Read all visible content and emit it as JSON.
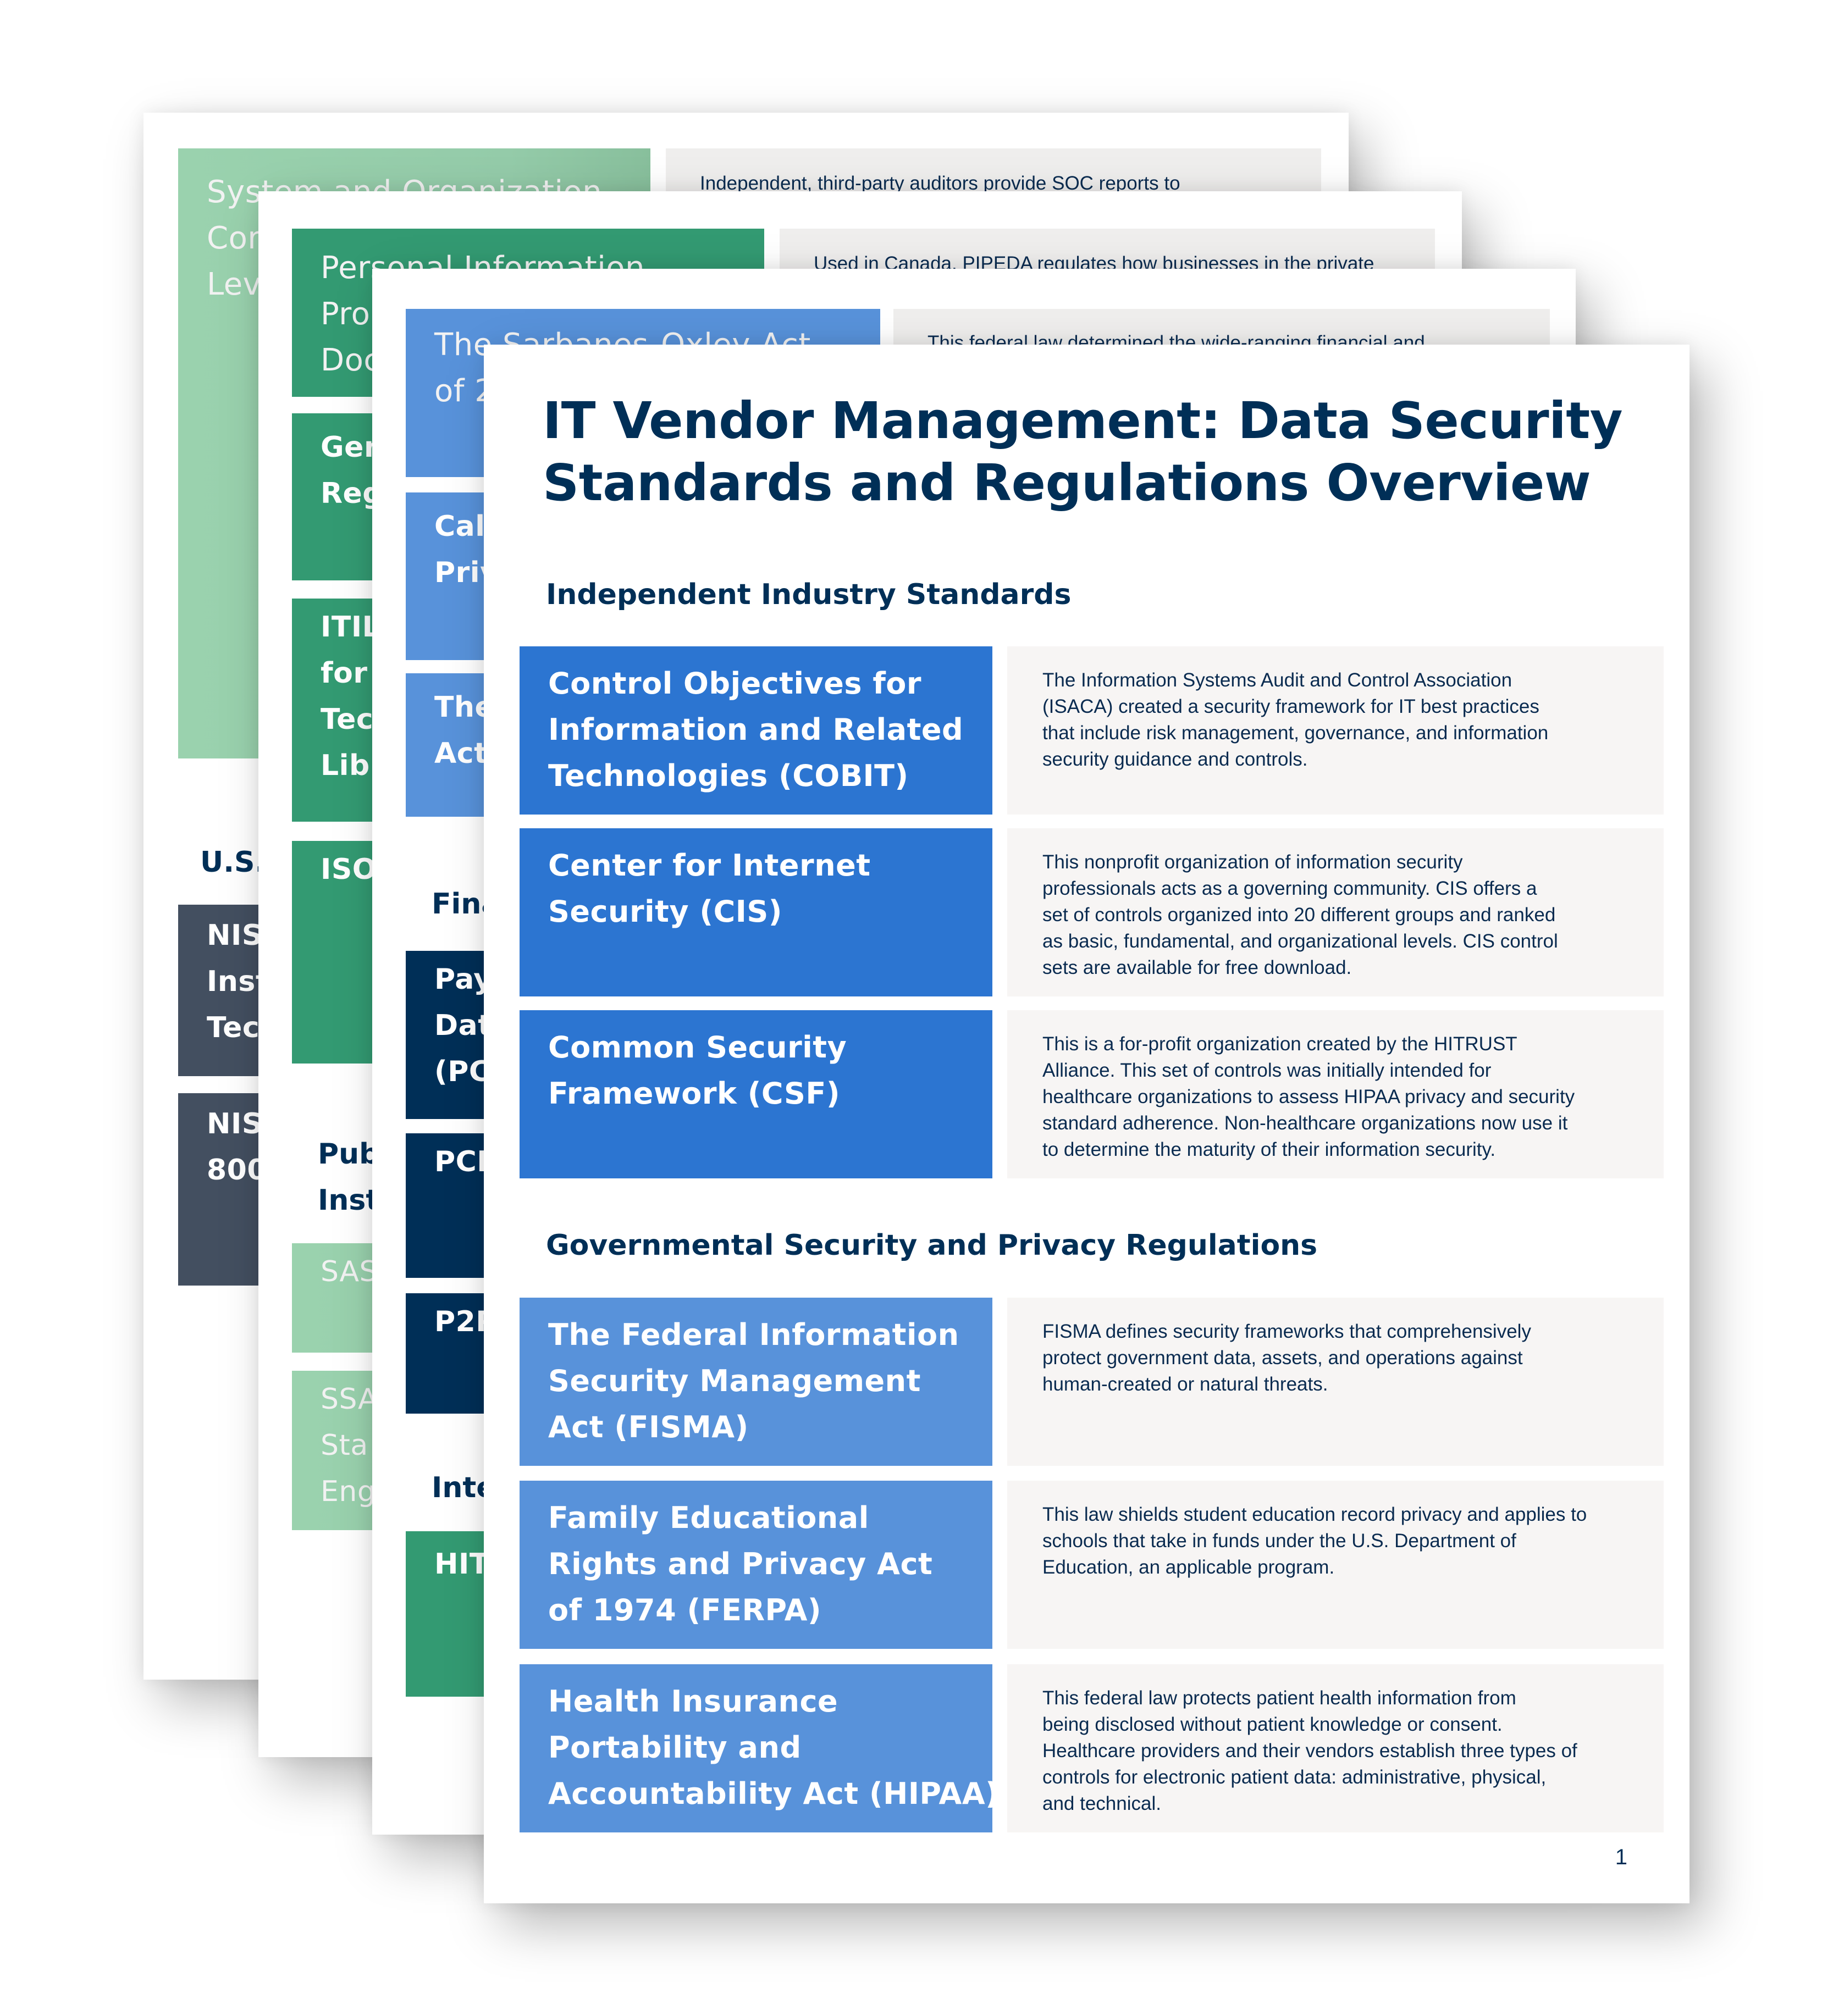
{
  "document": {
    "title_lines": [
      "IT Vendor Management: Data Security",
      "Standards and Regulations Overview"
    ],
    "page_number": "1",
    "sections": [
      {
        "heading": "Independent Industry Standards",
        "rows": [
          {
            "label_lines": [
              "Control Objectives for",
              "Information and Related",
              "Technologies (COBIT)"
            ],
            "description_lines": [
              "The Information Systems Audit and Control Association",
              "(ISACA) created a security framework for IT best practices",
              "that include risk management, governance, and information",
              "security guidance and controls."
            ]
          },
          {
            "label_lines": [
              "Center for Internet",
              "Security (CIS)"
            ],
            "description_lines": [
              "This nonprofit organization of information security",
              "professionals acts as a governing community. CIS offers a",
              "set of controls organized into 20 different groups and ranked",
              "as basic, fundamental, and organizational levels. CIS control",
              "sets are available for free download."
            ]
          },
          {
            "label_lines": [
              "Common Security",
              "Framework (CSF)"
            ],
            "description_lines": [
              "This is a for-profit organization created by the HITRUST",
              "Alliance. This set of controls was initially intended for",
              "healthcare organizations to assess HIPAA privacy and security",
              "standard adherence. Non-healthcare organizations now use it",
              "to determine the maturity of their information security."
            ]
          }
        ]
      },
      {
        "heading": "Governmental Security and Privacy Regulations",
        "rows": [
          {
            "label_lines": [
              "The Federal Information",
              "Security Management",
              "Act (FISMA)"
            ],
            "description_lines": [
              "FISMA defines security frameworks that comprehensively",
              "protect government data, assets, and operations against",
              "human-created or natural threats."
            ]
          },
          {
            "label_lines": [
              "Family Educational",
              "Rights and Privacy Act",
              "of 1974 (FERPA)"
            ],
            "description_lines": [
              "This law shields student education record privacy and applies to",
              "schools that take in funds under the U.S. Department of",
              "Education, an applicable program."
            ]
          },
          {
            "label_lines": [
              "Health Insurance",
              "Portability and",
              "Accountability Act (HIPAA)"
            ],
            "description_lines": [
              "This federal law protects patient health information from",
              "being disclosed without patient knowledge or consent.",
              "Healthcare providers and their vendors establish three types of",
              "controls for electronic patient data: administrative, physical,",
              "and technical."
            ]
          }
        ]
      }
    ]
  },
  "back_pages": {
    "page_a": {
      "soc_label_lines": [
        "System and Organization",
        "Cor",
        "Lev"
      ],
      "soc_description": "Independent, third-party auditors provide SOC reports to",
      "us_heading": "U.S.",
      "nist_a_lines": [
        "NIS",
        "Inst",
        "Tec"
      ],
      "nist_b_lines": [
        "NIS",
        "800"
      ]
    },
    "page_b": {
      "pipeda_label_lines": [
        "Personal Information",
        "Pro",
        "Doc"
      ],
      "pipeda_description": "Used in Canada, PIPEDA regulates how businesses in the private",
      "gdpr_lines": [
        "Gen",
        "Reg"
      ],
      "itil_lines": [
        "ITIL",
        "for",
        "Tec",
        "Lib"
      ],
      "iso_lines": [
        "ISO"
      ],
      "public_heading_lines": [
        "Pub",
        "Inst"
      ],
      "sas_lines": [
        "SAS"
      ],
      "ssae_lines": [
        "SSA",
        "Sta",
        "Eng"
      ]
    },
    "page_c": {
      "sox_label_lines": [
        "The Sarbanes-Oxley Act",
        "of 2"
      ],
      "sox_description": "This federal law determined the wide-ranging financial and",
      "ccpa_lines": [
        "Cal",
        "Priv"
      ],
      "third_lines": [
        "The",
        "Act"
      ],
      "finance_heading": "Fina",
      "pci_dss_lines": [
        "Pay",
        "Dat",
        "(PC"
      ],
      "pci_lines": [
        "PCI"
      ],
      "p2pe_lines": [
        "P2P"
      ],
      "intl_heading": "Inte",
      "hitrust_lines": [
        "HIT"
      ]
    }
  },
  "colors": {
    "navy_text": "#002f57",
    "cobit_blue": "#2c75d1",
    "gov_blue": "#5892da",
    "green": "#339a72",
    "light_green": "#97cfab",
    "slate": "#434f60",
    "desc_background": "#f7f5f4"
  }
}
